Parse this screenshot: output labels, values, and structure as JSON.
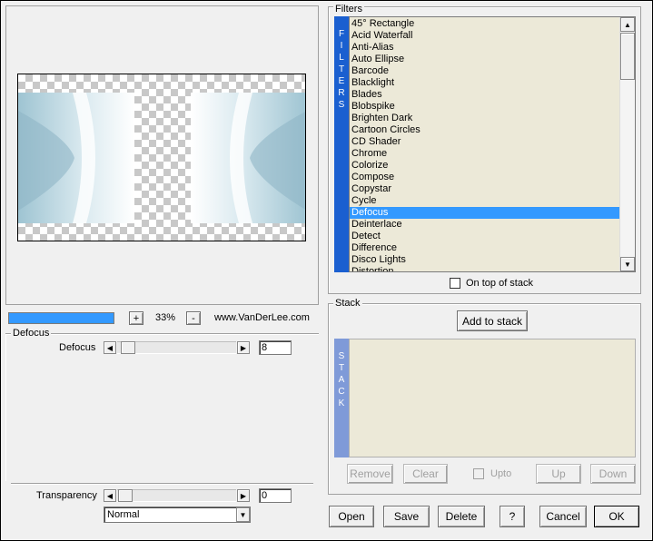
{
  "preview": {
    "zoom": "33%",
    "plus": "+",
    "minus": "-",
    "credit": "www.VanDerLee.com",
    "progress": 1.0
  },
  "filters": {
    "title": "Filters",
    "side_label": [
      "F",
      "I",
      "L",
      "T",
      "E",
      "R",
      "S"
    ],
    "items": [
      "45° Rectangle",
      "Acid Waterfall",
      "Anti-Alias",
      "Auto Ellipse",
      "Barcode",
      "Blacklight",
      "Blades",
      "Blobspike",
      "Brighten Dark",
      "Cartoon Circles",
      "CD Shader",
      "Chrome",
      "Colorize",
      "Compose",
      "Copystar",
      "Cycle",
      "Defocus",
      "Deinterlace",
      "Detect",
      "Difference",
      "Disco Lights",
      "Distortion"
    ],
    "selected_index": 16,
    "on_top_label": "On top of stack"
  },
  "defocus": {
    "title": "Defocus",
    "param_label": "Defocus",
    "param_value": "8",
    "param_level": 0.03
  },
  "transparency": {
    "label": "Transparency",
    "value": "0",
    "level": 0.0,
    "blend_mode": "Normal"
  },
  "stack": {
    "title": "Stack",
    "add_label": "Add to stack",
    "side_label": [
      "S",
      "T",
      "A",
      "C",
      "K"
    ],
    "remove": "Remove",
    "clear": "Clear",
    "upto": "Upto",
    "up": "Up",
    "down": "Down"
  },
  "footer": {
    "open": "Open",
    "save": "Save",
    "delete": "Delete",
    "help": "?",
    "cancel": "Cancel",
    "ok": "OK"
  },
  "colors": {
    "selection": "#3399ff",
    "side_bar_filters": "#1a5fd0",
    "side_bar_stack": "#7f9ad8",
    "list_bg": "#ece9d8"
  }
}
